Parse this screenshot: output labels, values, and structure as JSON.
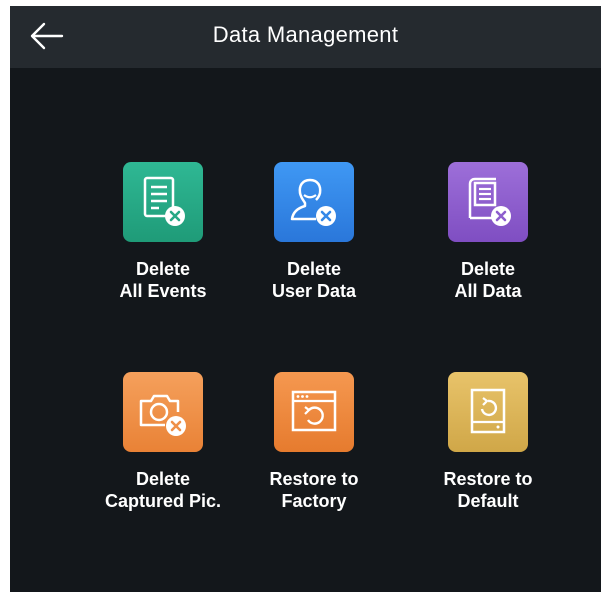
{
  "header": {
    "title": "Data Management",
    "back_icon": "arrow-left-icon"
  },
  "tiles": [
    {
      "line1": "Delete",
      "line2": "All Events",
      "icon": "event-list-delete-icon",
      "color": "#26a886"
    },
    {
      "line1": "Delete",
      "line2": "User Data",
      "icon": "user-delete-icon",
      "color": "#3388e8"
    },
    {
      "line1": "Delete",
      "line2": "All Data",
      "icon": "data-delete-icon",
      "color": "#8d5ecd"
    },
    {
      "line1": "Delete",
      "line2": "Captured Pic.",
      "icon": "camera-delete-icon",
      "color": "#ef9048"
    },
    {
      "line1": "Restore to",
      "line2": "Factory",
      "icon": "restore-factory-icon",
      "color": "#ee8a3e"
    },
    {
      "line1": "Restore to",
      "line2": "Default",
      "icon": "restore-default-icon",
      "color": "#ddb558"
    }
  ]
}
